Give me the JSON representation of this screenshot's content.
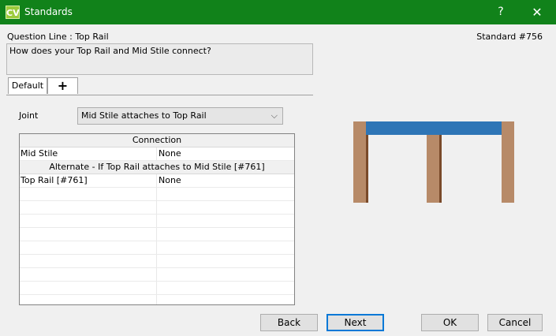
{
  "window": {
    "title": "Standards",
    "icon_text": "CV",
    "help_label": "?",
    "close_label": "✕"
  },
  "header": {
    "question_line": "Question Line : Top Rail",
    "standard_number": "Standard #756"
  },
  "question": {
    "text": "How does your Top Rail and Mid Stile connect?"
  },
  "tabs": [
    {
      "label": "Default"
    },
    {
      "label": "+"
    }
  ],
  "joint": {
    "label": "Joint",
    "selected": "Mid Stile attaches to Top Rail"
  },
  "grid": {
    "header1": "Connection",
    "row1": {
      "part": "Mid Stile",
      "value": "None"
    },
    "header2": "Alternate - If Top Rail attaches to Mid Stile [#761]",
    "row2": {
      "part": "Top Rail [#761]",
      "value": "None"
    }
  },
  "colors": {
    "title_bar": "#11821a",
    "top_rail": "#2e75b6",
    "stile": "#b78a68"
  },
  "buttons": {
    "back": "Back",
    "next": "Next",
    "ok": "OK",
    "cancel": "Cancel"
  }
}
